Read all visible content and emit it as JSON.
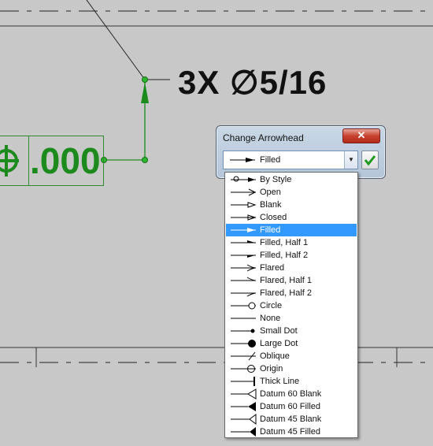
{
  "drawing": {
    "dimension_text": "3X ∅5/16",
    "fcf_value": ".000"
  },
  "dialog": {
    "title": "Change Arrowhead",
    "close_label": "✕",
    "selected_value": "Filled"
  },
  "arrowheads": [
    {
      "label": "By Style",
      "icon": "by-style-icon"
    },
    {
      "label": "Open",
      "icon": "open-arrow-icon"
    },
    {
      "label": "Blank",
      "icon": "blank-arrow-icon"
    },
    {
      "label": "Closed",
      "icon": "closed-arrow-icon"
    },
    {
      "label": "Filled",
      "icon": "filled-arrow-icon",
      "selected": true
    },
    {
      "label": "Filled, Half 1",
      "icon": "filled-half1-icon"
    },
    {
      "label": "Filled, Half 2",
      "icon": "filled-half2-icon"
    },
    {
      "label": "Flared",
      "icon": "flared-arrow-icon"
    },
    {
      "label": "Flared, Half 1",
      "icon": "flared-half1-icon"
    },
    {
      "label": "Flared, Half 2",
      "icon": "flared-half2-icon"
    },
    {
      "label": "Circle",
      "icon": "circle-icon"
    },
    {
      "label": "None",
      "icon": "none-icon"
    },
    {
      "label": "Small Dot",
      "icon": "small-dot-icon"
    },
    {
      "label": "Large Dot",
      "icon": "large-dot-icon"
    },
    {
      "label": "Oblique",
      "icon": "oblique-icon"
    },
    {
      "label": "Origin",
      "icon": "origin-icon"
    },
    {
      "label": "Thick Line",
      "icon": "thick-line-icon"
    },
    {
      "label": "Datum 60 Blank",
      "icon": "datum-60-blank-icon"
    },
    {
      "label": "Datum 60 Filled",
      "icon": "datum-60-filled-icon"
    },
    {
      "label": "Datum 45 Blank",
      "icon": "datum-45-blank-icon"
    },
    {
      "label": "Datum 45 Filled",
      "icon": "datum-45-filled-icon"
    }
  ],
  "colors": {
    "canvas": "#c8c8c8",
    "annotation_green": "#1d8a1d",
    "selection_blue": "#3399ff"
  }
}
